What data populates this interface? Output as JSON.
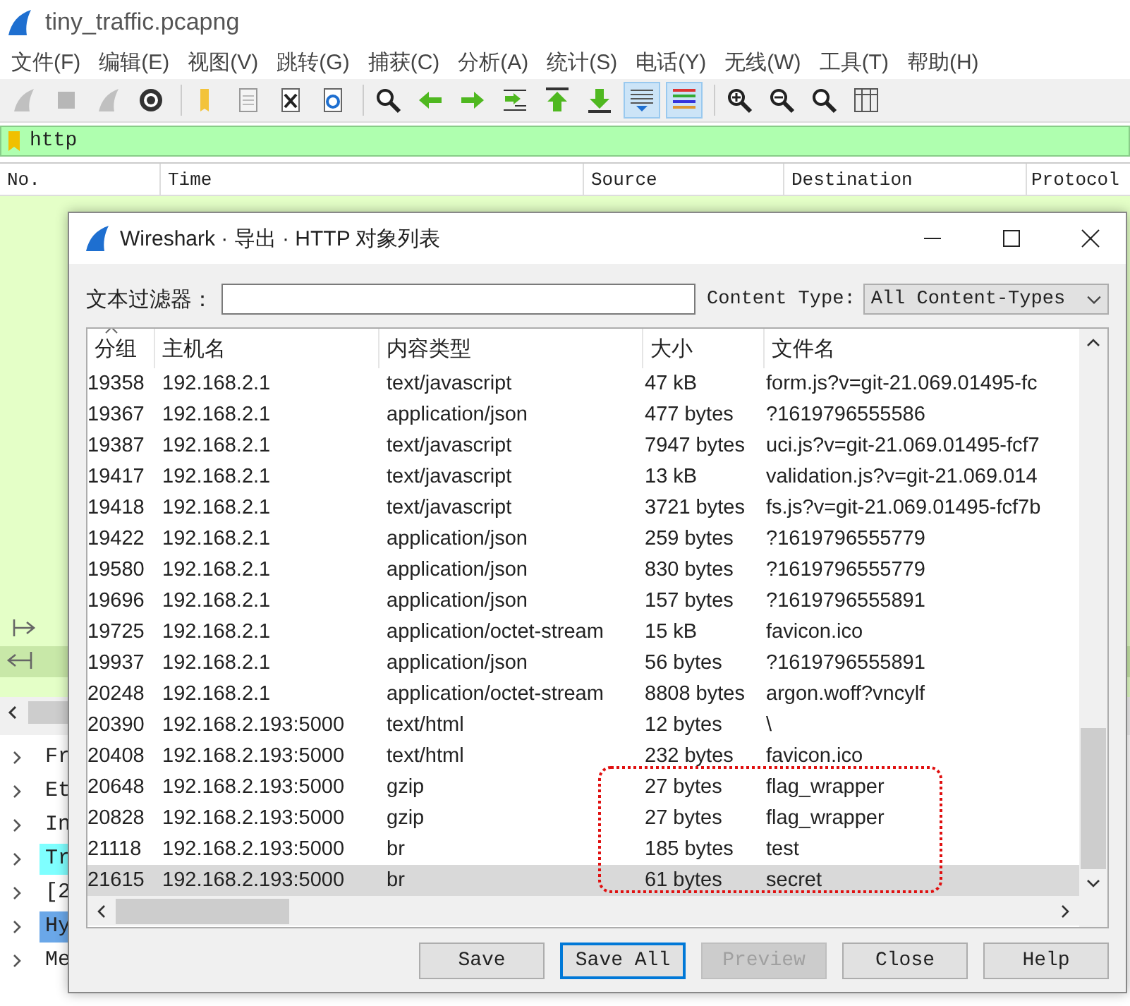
{
  "window": {
    "title": "tiny_traffic.pcapng"
  },
  "menu": [
    "文件(F)",
    "编辑(E)",
    "视图(V)",
    "跳转(G)",
    "捕获(C)",
    "分析(A)",
    "统计(S)",
    "电话(Y)",
    "无线(W)",
    "工具(T)",
    "帮助(H)"
  ],
  "toolbar": [
    {
      "disabled": true,
      "pressed": false
    },
    {
      "disabled": true,
      "pressed": false
    },
    {
      "disabled": true,
      "pressed": false
    },
    {
      "disabled": false,
      "pressed": false
    },
    {
      "disabled": false,
      "pressed": false
    },
    {
      "disabled": false,
      "pressed": false
    },
    {
      "disabled": false,
      "pressed": false
    },
    {
      "disabled": false,
      "pressed": false
    },
    {
      "disabled": false,
      "pressed": false
    },
    {
      "disabled": false,
      "pressed": false
    },
    {
      "disabled": false,
      "pressed": false
    },
    {
      "disabled": false,
      "pressed": false
    },
    {
      "disabled": false,
      "pressed": false
    },
    {
      "disabled": false,
      "pressed": false
    },
    {
      "disabled": false,
      "pressed": true
    },
    {
      "disabled": false,
      "pressed": true
    },
    {
      "disabled": false,
      "pressed": false
    },
    {
      "disabled": false,
      "pressed": false
    },
    {
      "disabled": false,
      "pressed": false
    },
    {
      "disabled": false,
      "pressed": false
    }
  ],
  "display_filter": {
    "value": "http"
  },
  "packet_list": {
    "columns": [
      "No.",
      "Time",
      "Source",
      "Destination",
      "Protocol"
    ]
  },
  "packet_details": [
    {
      "label": "Fr",
      "highlighted": false,
      "selected": false
    },
    {
      "label": "Et",
      "highlighted": false,
      "selected": false
    },
    {
      "label": "In",
      "highlighted": false,
      "selected": false
    },
    {
      "label": "Tr",
      "highlighted": true,
      "selected": false
    },
    {
      "label": "[2",
      "highlighted": false,
      "selected": false
    },
    {
      "label": "Hy",
      "highlighted": false,
      "selected": true
    },
    {
      "label": "Me",
      "highlighted": false,
      "selected": false
    }
  ],
  "dialog": {
    "title": "Wireshark · 导出 · HTTP 对象列表",
    "text_filter": {
      "label": "文本过滤器："
    },
    "content_type": {
      "label": "Content Type:",
      "value": "All Content-Types"
    },
    "table": {
      "columns": [
        {
          "label": "分组",
          "sorted": true
        },
        {
          "label": "主机名",
          "sorted": false
        },
        {
          "label": "内容类型",
          "sorted": false
        },
        {
          "label": "大小",
          "sorted": false
        },
        {
          "label": "文件名",
          "sorted": false
        }
      ],
      "rows": [
        {
          "packet": "19358",
          "host": "192.168.2.1",
          "type": "text/javascript",
          "size": "47 kB",
          "file": "form.js?v=git-21.069.01495-fc",
          "selected": false,
          "marked": false
        },
        {
          "packet": "19367",
          "host": "192.168.2.1",
          "type": "application/json",
          "size": "477 bytes",
          "file": "?1619796555586",
          "selected": false,
          "marked": false
        },
        {
          "packet": "19387",
          "host": "192.168.2.1",
          "type": "text/javascript",
          "size": "7947 bytes",
          "file": "uci.js?v=git-21.069.01495-fcf7",
          "selected": false,
          "marked": false
        },
        {
          "packet": "19417",
          "host": "192.168.2.1",
          "type": "text/javascript",
          "size": "13 kB",
          "file": "validation.js?v=git-21.069.014",
          "selected": false,
          "marked": false
        },
        {
          "packet": "19418",
          "host": "192.168.2.1",
          "type": "text/javascript",
          "size": "3721 bytes",
          "file": "fs.js?v=git-21.069.01495-fcf7b",
          "selected": false,
          "marked": false
        },
        {
          "packet": "19422",
          "host": "192.168.2.1",
          "type": "application/json",
          "size": "259 bytes",
          "file": "?1619796555779",
          "selected": false,
          "marked": false
        },
        {
          "packet": "19580",
          "host": "192.168.2.1",
          "type": "application/json",
          "size": "830 bytes",
          "file": "?1619796555779",
          "selected": false,
          "marked": false
        },
        {
          "packet": "19696",
          "host": "192.168.2.1",
          "type": "application/json",
          "size": "157 bytes",
          "file": "?1619796555891",
          "selected": false,
          "marked": false
        },
        {
          "packet": "19725",
          "host": "192.168.2.1",
          "type": "application/octet-stream",
          "size": "15 kB",
          "file": "favicon.ico",
          "selected": false,
          "marked": false
        },
        {
          "packet": "19937",
          "host": "192.168.2.1",
          "type": "application/json",
          "size": "56 bytes",
          "file": "?1619796555891",
          "selected": false,
          "marked": false
        },
        {
          "packet": "20248",
          "host": "192.168.2.1",
          "type": "application/octet-stream",
          "size": "8808 bytes",
          "file": "argon.woff?vncylf",
          "selected": false,
          "marked": false
        },
        {
          "packet": "20390",
          "host": "192.168.2.193:5000",
          "type": "text/html",
          "size": "12 bytes",
          "file": "\\",
          "selected": false,
          "marked": false
        },
        {
          "packet": "20408",
          "host": "192.168.2.193:5000",
          "type": "text/html",
          "size": "232 bytes",
          "file": "favicon.ico",
          "selected": false,
          "marked": false
        },
        {
          "packet": "20648",
          "host": "192.168.2.193:5000",
          "type": "gzip",
          "size": "27 bytes",
          "file": "flag_wrapper",
          "selected": false,
          "marked": true
        },
        {
          "packet": "20828",
          "host": "192.168.2.193:5000",
          "type": "gzip",
          "size": "27 bytes",
          "file": "flag_wrapper",
          "selected": false,
          "marked": true
        },
        {
          "packet": "21118",
          "host": "192.168.2.193:5000",
          "type": "br",
          "size": "185 bytes",
          "file": "test",
          "selected": false,
          "marked": true
        },
        {
          "packet": "21615",
          "host": "192.168.2.193:5000",
          "type": "br",
          "size": "61 bytes",
          "file": "secret",
          "selected": true,
          "marked": true
        }
      ]
    },
    "buttons": [
      {
        "label": "Save",
        "focused": false,
        "disabled": false
      },
      {
        "label": "Save All",
        "focused": true,
        "disabled": false
      },
      {
        "label": "Preview",
        "focused": false,
        "disabled": true
      },
      {
        "label": "Close",
        "focused": false,
        "disabled": false
      },
      {
        "label": "Help",
        "focused": false,
        "disabled": false
      }
    ]
  }
}
